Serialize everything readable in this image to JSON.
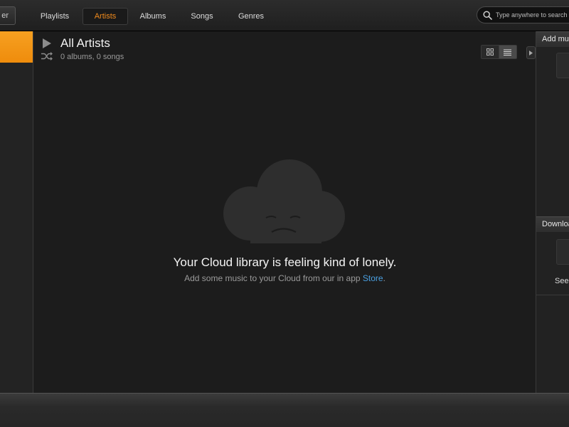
{
  "topbar": {
    "left_button_label": "er",
    "tabs": [
      {
        "label": "Playlists",
        "active": false
      },
      {
        "label": "Artists",
        "active": true
      },
      {
        "label": "Albums",
        "active": false
      },
      {
        "label": "Songs",
        "active": false
      },
      {
        "label": "Genres",
        "active": false
      }
    ],
    "search": {
      "placeholder": "Type anywhere to search",
      "icon": "search-icon"
    }
  },
  "main": {
    "title": "All Artists",
    "subtitle": "0 albums, 0 songs",
    "empty_state": {
      "title": "Your Cloud library is feeling kind of lonely.",
      "subtitle_prefix": "Add some music to your Cloud from our in app ",
      "link_text": "Store",
      "subtitle_suffix": "."
    }
  },
  "right_panel": {
    "add_music_label": "Add music",
    "downloads_label": "Downloads",
    "see_all_label": "See all"
  },
  "colors": {
    "accent": "#f08a1c",
    "link": "#4a9fe0",
    "background": "#1c1c1c"
  }
}
